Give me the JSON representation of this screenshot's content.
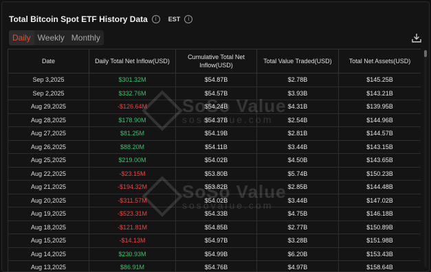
{
  "header": {
    "title": "Total Bitcoin Spot ETF History Data",
    "timezone": "EST"
  },
  "tabs": [
    {
      "label": "Daily",
      "active": true
    },
    {
      "label": "Weekly",
      "active": false
    },
    {
      "label": "Monthly",
      "active": false
    }
  ],
  "table": {
    "columns": [
      "Date",
      "Daily Total Net Inflow(USD)",
      "Cumulative Total Net Inflow(USD)",
      "Total Value Traded(USD)",
      "Total Net Assets(USD)"
    ],
    "rows": [
      {
        "date": "Sep 3,2025",
        "inflow": "$301.32M",
        "cumulative": "$54.87B",
        "traded": "$2.78B",
        "assets": "$145.25B",
        "sign": "pos"
      },
      {
        "date": "Sep 2,2025",
        "inflow": "$332.76M",
        "cumulative": "$54.57B",
        "traded": "$3.93B",
        "assets": "$143.21B",
        "sign": "pos"
      },
      {
        "date": "Aug 29,2025",
        "inflow": "-$126.64M",
        "cumulative": "$54.24B",
        "traded": "$4.31B",
        "assets": "$139.95B",
        "sign": "neg"
      },
      {
        "date": "Aug 28,2025",
        "inflow": "$178.90M",
        "cumulative": "$54.37B",
        "traded": "$2.54B",
        "assets": "$144.96B",
        "sign": "pos"
      },
      {
        "date": "Aug 27,2025",
        "inflow": "$81.25M",
        "cumulative": "$54.19B",
        "traded": "$2.81B",
        "assets": "$144.57B",
        "sign": "pos"
      },
      {
        "date": "Aug 26,2025",
        "inflow": "$88.20M",
        "cumulative": "$54.11B",
        "traded": "$3.44B",
        "assets": "$143.15B",
        "sign": "pos"
      },
      {
        "date": "Aug 25,2025",
        "inflow": "$219.00M",
        "cumulative": "$54.02B",
        "traded": "$4.50B",
        "assets": "$143.65B",
        "sign": "pos"
      },
      {
        "date": "Aug 22,2025",
        "inflow": "-$23.15M",
        "cumulative": "$53.80B",
        "traded": "$5.74B",
        "assets": "$150.23B",
        "sign": "neg"
      },
      {
        "date": "Aug 21,2025",
        "inflow": "-$194.32M",
        "cumulative": "$53.82B",
        "traded": "$2.85B",
        "assets": "$144.48B",
        "sign": "neg"
      },
      {
        "date": "Aug 20,2025",
        "inflow": "-$311.57M",
        "cumulative": "$54.02B",
        "traded": "$3.44B",
        "assets": "$147.02B",
        "sign": "neg"
      },
      {
        "date": "Aug 19,2025",
        "inflow": "-$523.31M",
        "cumulative": "$54.33B",
        "traded": "$4.75B",
        "assets": "$146.18B",
        "sign": "neg"
      },
      {
        "date": "Aug 18,2025",
        "inflow": "-$121.81M",
        "cumulative": "$54.85B",
        "traded": "$2.77B",
        "assets": "$150.89B",
        "sign": "neg"
      },
      {
        "date": "Aug 15,2025",
        "inflow": "-$14.13M",
        "cumulative": "$54.97B",
        "traded": "$3.28B",
        "assets": "$151.98B",
        "sign": "neg"
      },
      {
        "date": "Aug 14,2025",
        "inflow": "$230.93M",
        "cumulative": "$54.99B",
        "traded": "$6.20B",
        "assets": "$153.43B",
        "sign": "pos"
      },
      {
        "date": "Aug 13,2025",
        "inflow": "$86.91M",
        "cumulative": "$54.76B",
        "traded": "$4.97B",
        "assets": "$158.64B",
        "sign": "pos"
      }
    ]
  },
  "watermark": {
    "brand": "SoSo Value",
    "url": "sosovalue.com"
  },
  "colors": {
    "positive": "#36c56b",
    "negative": "#ef4343",
    "active_tab": "#f0492d"
  },
  "icons": {
    "info": "info-icon",
    "download": "download-icon"
  }
}
